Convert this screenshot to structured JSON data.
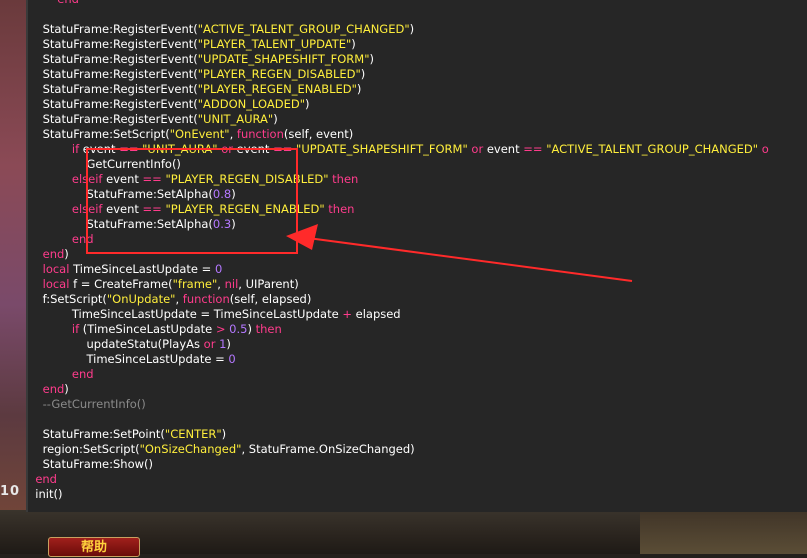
{
  "code_lines": [
    [
      {
        "t": "        ",
        "c": "plain"
      },
      {
        "t": "end",
        "c": "kw"
      }
    ],
    [
      {
        "t": "",
        "c": "plain"
      }
    ],
    [
      {
        "t": "    StatuFrame:RegisterEvent(",
        "c": "plain"
      },
      {
        "t": "\"ACTIVE_TALENT_GROUP_CHANGED\"",
        "c": "str"
      },
      {
        "t": ")",
        "c": "plain"
      }
    ],
    [
      {
        "t": "    StatuFrame:RegisterEvent(",
        "c": "plain"
      },
      {
        "t": "\"PLAYER_TALENT_UPDATE\"",
        "c": "str"
      },
      {
        "t": ")",
        "c": "plain"
      }
    ],
    [
      {
        "t": "    StatuFrame:RegisterEvent(",
        "c": "plain"
      },
      {
        "t": "\"UPDATE_SHAPESHIFT_FORM\"",
        "c": "str"
      },
      {
        "t": ")",
        "c": "plain"
      }
    ],
    [
      {
        "t": "    StatuFrame:RegisterEvent(",
        "c": "plain"
      },
      {
        "t": "\"PLAYER_REGEN_DISABLED\"",
        "c": "str"
      },
      {
        "t": ")",
        "c": "plain"
      }
    ],
    [
      {
        "t": "    StatuFrame:RegisterEvent(",
        "c": "plain"
      },
      {
        "t": "\"PLAYER_REGEN_ENABLED\"",
        "c": "str"
      },
      {
        "t": ")",
        "c": "plain"
      }
    ],
    [
      {
        "t": "    StatuFrame:RegisterEvent(",
        "c": "plain"
      },
      {
        "t": "\"ADDON_LOADED\"",
        "c": "str"
      },
      {
        "t": ")",
        "c": "plain"
      }
    ],
    [
      {
        "t": "    StatuFrame:RegisterEvent(",
        "c": "plain"
      },
      {
        "t": "\"UNIT_AURA\"",
        "c": "str"
      },
      {
        "t": ")",
        "c": "plain"
      }
    ],
    [
      {
        "t": "    StatuFrame:SetScript(",
        "c": "plain"
      },
      {
        "t": "\"OnEvent\"",
        "c": "str"
      },
      {
        "t": ", ",
        "c": "plain"
      },
      {
        "t": "function",
        "c": "kw"
      },
      {
        "t": "(self, event)",
        "c": "plain"
      }
    ],
    [
      {
        "t": "            ",
        "c": "plain"
      },
      {
        "t": "if",
        "c": "kw"
      },
      {
        "t": " event ",
        "c": "plain"
      },
      {
        "t": "==",
        "c": "kw"
      },
      {
        "t": " ",
        "c": "plain"
      },
      {
        "t": "\"UNIT_AURA\"",
        "c": "str"
      },
      {
        "t": " ",
        "c": "plain"
      },
      {
        "t": "or",
        "c": "kw"
      },
      {
        "t": " event ",
        "c": "plain"
      },
      {
        "t": "==",
        "c": "kw"
      },
      {
        "t": " ",
        "c": "plain"
      },
      {
        "t": "\"UPDATE_SHAPESHIFT_FORM\"",
        "c": "str"
      },
      {
        "t": " ",
        "c": "plain"
      },
      {
        "t": "or",
        "c": "kw"
      },
      {
        "t": " event ",
        "c": "plain"
      },
      {
        "t": "==",
        "c": "kw"
      },
      {
        "t": " ",
        "c": "plain"
      },
      {
        "t": "\"ACTIVE_TALENT_GROUP_CHANGED\"",
        "c": "str"
      },
      {
        "t": " o",
        "c": "kw"
      }
    ],
    [
      {
        "t": "                GetCurrentInfo()",
        "c": "plain"
      }
    ],
    [
      {
        "t": "            ",
        "c": "plain"
      },
      {
        "t": "elseif",
        "c": "kw"
      },
      {
        "t": " event ",
        "c": "plain"
      },
      {
        "t": "==",
        "c": "kw"
      },
      {
        "t": " ",
        "c": "plain"
      },
      {
        "t": "\"PLAYER_REGEN_DISABLED\"",
        "c": "str"
      },
      {
        "t": " ",
        "c": "plain"
      },
      {
        "t": "then",
        "c": "kw"
      }
    ],
    [
      {
        "t": "                StatuFrame:SetAlpha(",
        "c": "plain"
      },
      {
        "t": "0.8",
        "c": "num"
      },
      {
        "t": ")",
        "c": "plain"
      }
    ],
    [
      {
        "t": "            ",
        "c": "plain"
      },
      {
        "t": "elseif",
        "c": "kw"
      },
      {
        "t": " event ",
        "c": "plain"
      },
      {
        "t": "==",
        "c": "kw"
      },
      {
        "t": " ",
        "c": "plain"
      },
      {
        "t": "\"PLAYER_REGEN_ENABLED\"",
        "c": "str"
      },
      {
        "t": " ",
        "c": "plain"
      },
      {
        "t": "then",
        "c": "kw"
      }
    ],
    [
      {
        "t": "                StatuFrame:SetAlpha(",
        "c": "plain"
      },
      {
        "t": "0.3",
        "c": "num"
      },
      {
        "t": ")",
        "c": "plain"
      }
    ],
    [
      {
        "t": "            ",
        "c": "plain"
      },
      {
        "t": "end",
        "c": "kw"
      }
    ],
    [
      {
        "t": "    ",
        "c": "plain"
      },
      {
        "t": "end",
        "c": "kw"
      },
      {
        "t": ")",
        "c": "plain"
      }
    ],
    [
      {
        "t": "    ",
        "c": "plain"
      },
      {
        "t": "local",
        "c": "kw"
      },
      {
        "t": " TimeSinceLastUpdate = ",
        "c": "plain"
      },
      {
        "t": "0",
        "c": "num"
      }
    ],
    [
      {
        "t": "    ",
        "c": "plain"
      },
      {
        "t": "local",
        "c": "kw"
      },
      {
        "t": " f = CreateFrame(",
        "c": "plain"
      },
      {
        "t": "\"frame\"",
        "c": "str"
      },
      {
        "t": ", ",
        "c": "plain"
      },
      {
        "t": "nil",
        "c": "kw"
      },
      {
        "t": ", UIParent)",
        "c": "plain"
      }
    ],
    [
      {
        "t": "    f:SetScript(",
        "c": "plain"
      },
      {
        "t": "\"OnUpdate\"",
        "c": "str"
      },
      {
        "t": ", ",
        "c": "plain"
      },
      {
        "t": "function",
        "c": "kw"
      },
      {
        "t": "(self, elapsed)",
        "c": "plain"
      }
    ],
    [
      {
        "t": "            TimeSinceLastUpdate = TimeSinceLastUpdate ",
        "c": "plain"
      },
      {
        "t": "+",
        "c": "kw"
      },
      {
        "t": " elapsed",
        "c": "plain"
      }
    ],
    [
      {
        "t": "            ",
        "c": "plain"
      },
      {
        "t": "if",
        "c": "kw"
      },
      {
        "t": " (TimeSinceLastUpdate ",
        "c": "plain"
      },
      {
        "t": ">",
        "c": "kw"
      },
      {
        "t": " ",
        "c": "plain"
      },
      {
        "t": "0.5",
        "c": "num"
      },
      {
        "t": ") ",
        "c": "plain"
      },
      {
        "t": "then",
        "c": "kw"
      }
    ],
    [
      {
        "t": "                updateStatu(PlayAs ",
        "c": "plain"
      },
      {
        "t": "or",
        "c": "kw"
      },
      {
        "t": " ",
        "c": "plain"
      },
      {
        "t": "1",
        "c": "num"
      },
      {
        "t": ")",
        "c": "plain"
      }
    ],
    [
      {
        "t": "                TimeSinceLastUpdate = ",
        "c": "plain"
      },
      {
        "t": "0",
        "c": "num"
      }
    ],
    [
      {
        "t": "            ",
        "c": "plain"
      },
      {
        "t": "end",
        "c": "kw"
      }
    ],
    [
      {
        "t": "    ",
        "c": "plain"
      },
      {
        "t": "end",
        "c": "kw"
      },
      {
        "t": ")",
        "c": "plain"
      }
    ],
    [
      {
        "t": "    --GetCurrentInfo()",
        "c": "comment"
      }
    ],
    [
      {
        "t": "",
        "c": "plain"
      }
    ],
    [
      {
        "t": "    StatuFrame:SetPoint(",
        "c": "plain"
      },
      {
        "t": "\"CENTER\"",
        "c": "str"
      },
      {
        "t": ")",
        "c": "plain"
      }
    ],
    [
      {
        "t": "    region:SetScript(",
        "c": "plain"
      },
      {
        "t": "\"OnSizeChanged\"",
        "c": "str"
      },
      {
        "t": ", StatuFrame.OnSizeChanged)",
        "c": "plain"
      }
    ],
    [
      {
        "t": "    StatuFrame:Show()",
        "c": "plain"
      }
    ],
    [
      {
        "t": "  ",
        "c": "plain"
      },
      {
        "t": "end",
        "c": "kw"
      }
    ],
    [
      {
        "t": "  init()",
        "c": "plain"
      }
    ]
  ],
  "side_digits": "10",
  "faded_label": "",
  "help_button": "帮助",
  "colors": {
    "keyword": "#ff3c8c",
    "string": "#ffef3c",
    "number": "#b478ff",
    "comment": "#8a8a8a",
    "annotation": "#ff2a2a"
  }
}
